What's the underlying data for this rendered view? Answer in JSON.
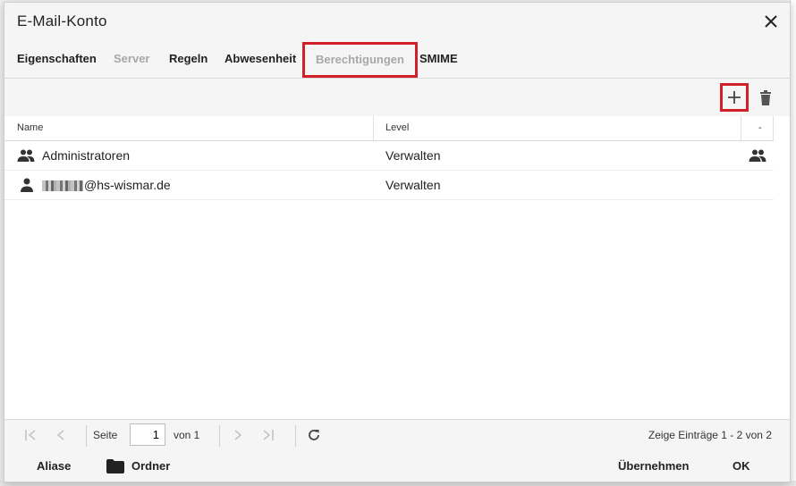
{
  "dialog": {
    "title": "E-Mail-Konto"
  },
  "tabs": [
    {
      "label": "Eigenschaften",
      "state": "normal"
    },
    {
      "label": "Server",
      "state": "disabled"
    },
    {
      "label": "Regeln",
      "state": "normal"
    },
    {
      "label": "Abwesenheit",
      "state": "normal"
    },
    {
      "label": "Berechtigungen",
      "state": "active-highlighted"
    },
    {
      "label": "SMIME",
      "state": "normal"
    }
  ],
  "toolbar": {
    "add_icon": "plus-icon",
    "delete_icon": "trash-icon"
  },
  "grid": {
    "columns": [
      "Name",
      "Level",
      "-"
    ],
    "rows": [
      {
        "icon": "group-icon",
        "name": "Administratoren",
        "level": "Verwalten",
        "type_icon": "group-icon"
      },
      {
        "icon": "user-icon",
        "name": "@hs-wismar.de",
        "level": "Verwalten",
        "type_icon": ""
      }
    ]
  },
  "pager": {
    "page_label": "Seite",
    "page_value": "1",
    "of_label": "von 1",
    "summary": "Zeige Einträge 1 - 2 von 2"
  },
  "footer": {
    "aliases": "Aliase",
    "folders": "Ordner",
    "apply": "Übernehmen",
    "ok": "OK"
  },
  "colors": {
    "highlight": "#d1202a",
    "disabled_text": "#a8a8a8"
  }
}
